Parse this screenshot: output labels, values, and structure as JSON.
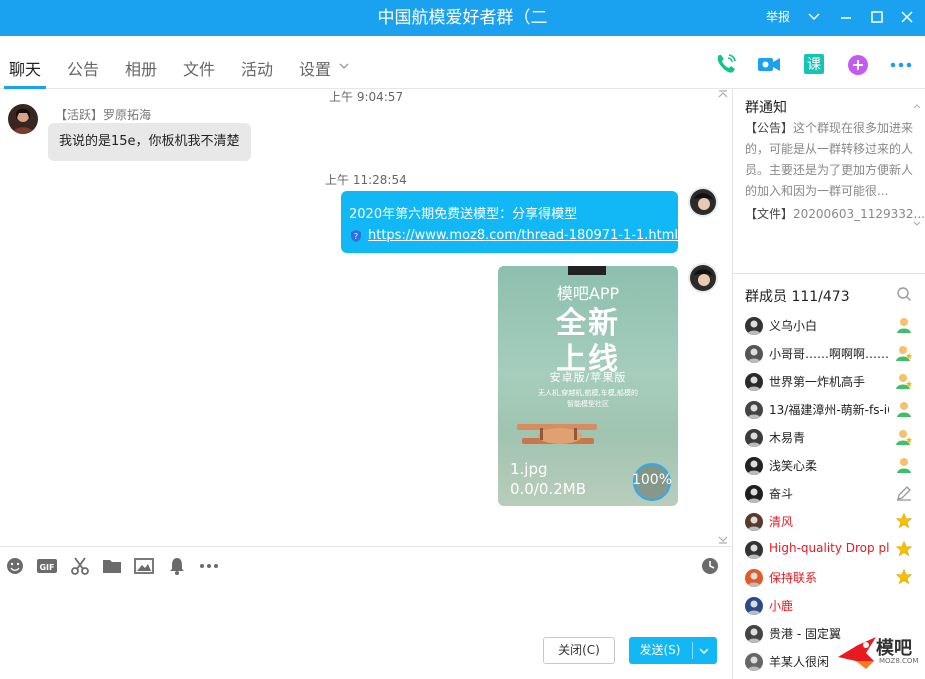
{
  "window": {
    "title": "中国航模爱好者群（二",
    "report_label": "举报",
    "controls": [
      "chevron-down-icon",
      "minimize-icon",
      "maximize-icon",
      "close-icon"
    ]
  },
  "tabs": {
    "items": [
      {
        "label": "聊天",
        "active": true
      },
      {
        "label": "公告",
        "active": false
      },
      {
        "label": "相册",
        "active": false
      },
      {
        "label": "文件",
        "active": false
      },
      {
        "label": "活动",
        "active": false
      },
      {
        "label": "设置",
        "active": false
      }
    ],
    "actions": [
      "phone-icon",
      "video-icon",
      "course-icon",
      "add-app-icon",
      "more-icon"
    ],
    "course_label": "课"
  },
  "chat": {
    "messages": [
      {
        "timestamp": "上午 9:04:57",
        "sender_badge": "【活跃】",
        "sender": "罗原拓海",
        "text": "我说的是15e，你板机我不清楚"
      },
      {
        "timestamp": "上午 11:28:54",
        "text": "2020年第六期免费送模型：分享得模型",
        "link": "https://www.moz8.com/thread-180971-1-1.html"
      },
      {
        "image": {
          "headline_small": "模吧APP",
          "headline_1": "全新",
          "headline_2": "上线",
          "platforms": "安卓版/苹果版",
          "tagline_1": "无人机,穿越机,航模,车模,船模的",
          "tagline_2": "智能模型社区",
          "file_name": "1.jpg",
          "file_size": "0.0/0.2MB",
          "progress_label": "100%",
          "progress": 1.0
        }
      }
    ]
  },
  "toolbar": {
    "tools": [
      "emoji-icon",
      "gif-icon",
      "scissors-icon",
      "folder-icon",
      "image-icon",
      "bell-icon",
      "more-icon",
      "history-clock-icon"
    ],
    "gif_label": "GIF"
  },
  "input": {
    "close_label": "关闭(C)",
    "send_label": "发送(S)"
  },
  "notice": {
    "title": "群通知",
    "tag": "【公告】",
    "body": "这个群现在很多加进来的，可能是从一群转移过来的人员。主要还是为了更加方便新人的加入和因为一群可能很...",
    "file_tag": "【文件】",
    "file_name": "20200603_1129332..."
  },
  "members": {
    "title": "群成员 111/473",
    "list": [
      {
        "name": "义乌小白",
        "red": false,
        "role": "member"
      },
      {
        "name": "小哥哥……啊啊啊……呀",
        "red": false,
        "role": "member-star"
      },
      {
        "name": "世界第一炸机高手",
        "red": false,
        "role": "member-star"
      },
      {
        "name": "13/福建漳州-萌新-fs-i6",
        "red": false,
        "role": "member"
      },
      {
        "name": "木易青",
        "red": false,
        "role": "member-star"
      },
      {
        "name": "浅笑心柔",
        "red": false,
        "role": "member"
      },
      {
        "name": "奋斗",
        "red": false,
        "role": "pencil"
      },
      {
        "name": "清风",
        "red": true,
        "role": "star"
      },
      {
        "name": "High-quality Drop pl",
        "red": true,
        "role": "star"
      },
      {
        "name": "保持联系",
        "red": true,
        "role": "star"
      },
      {
        "name": "小鹿",
        "red": true,
        "role": "none"
      },
      {
        "name": "贵港 - 固定翼",
        "red": false,
        "role": "none"
      },
      {
        "name": "羊某人很闲",
        "red": false,
        "role": "none"
      }
    ]
  },
  "watermark": {
    "text": "模吧",
    "sub": "MOZ8.COM"
  },
  "colors": {
    "accent": "#12b7f5",
    "titlebar": "#1aa2f0",
    "red_name": "#e8191f"
  }
}
